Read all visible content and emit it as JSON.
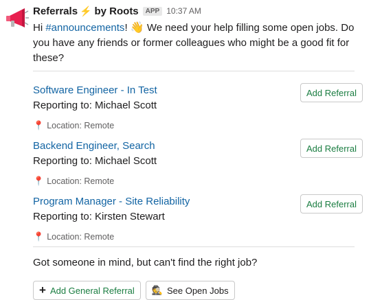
{
  "message": {
    "sender": "Referrals",
    "bolt_icon": "⚡",
    "sender_suffix": "by Roots",
    "app_badge": "APP",
    "time": "10:37 AM",
    "intro_prefix": "Hi ",
    "channel": "#announcements",
    "intro_mid": "! ",
    "wave_emoji": "👋",
    "intro_suffix": " We need your help filling some open jobs. Do you have any friends or former colleagues who might be a good fit for these?"
  },
  "jobs": [
    {
      "title": "Software Engineer - In Test",
      "reporting": "Reporting to: Michael Scott",
      "location": "Location: Remote",
      "button": "Add Referral"
    },
    {
      "title": "Backend Engineer, Search",
      "reporting": "Reporting to: Michael Scott",
      "location": "Location: Remote",
      "button": "Add Referral"
    },
    {
      "title": "Program Manager - Site Reliability",
      "reporting": "Reporting to: Kirsten Stewart",
      "location": "Location: Remote",
      "button": "Add Referral"
    }
  ],
  "footer": {
    "text": "Got someone in mind, but can't find the right job?",
    "general_button": "Add General Referral",
    "open_jobs_button": "See Open Jobs",
    "plus_icon": "+",
    "detective_icon": "🕵",
    "pin_icon": "📍"
  },
  "colors": {
    "link": "#1264a3",
    "button_text": "#1a7d41",
    "megaphone": "#e8204f"
  }
}
